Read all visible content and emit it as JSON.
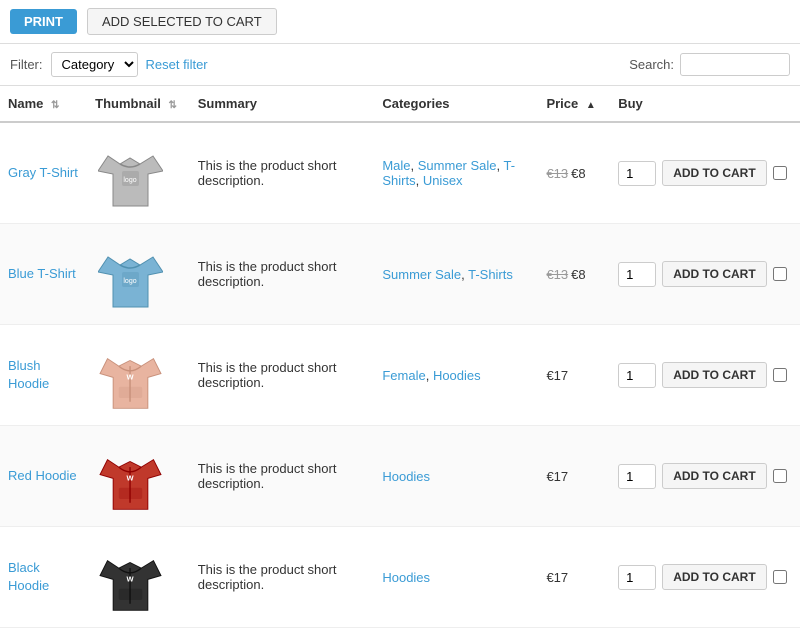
{
  "topBar": {
    "printLabel": "PRINT",
    "addSelectedLabel": "ADD SELECTED TO CART"
  },
  "filterBar": {
    "filterLabel": "Filter:",
    "categoryLabel": "Category",
    "resetLabel": "Reset filter",
    "searchLabel": "Search:",
    "searchPlaceholder": ""
  },
  "table": {
    "headers": [
      {
        "id": "name",
        "label": "Name",
        "sortable": true
      },
      {
        "id": "thumbnail",
        "label": "Thumbnail",
        "sortable": true
      },
      {
        "id": "summary",
        "label": "Summary",
        "sortable": false
      },
      {
        "id": "categories",
        "label": "Categories",
        "sortable": false
      },
      {
        "id": "price",
        "label": "Price",
        "sortable": true,
        "activeSort": "asc"
      },
      {
        "id": "buy",
        "label": "Buy",
        "sortable": false
      }
    ],
    "rows": [
      {
        "id": 1,
        "name": "Gray T-Shirt",
        "summary": "This is the product short description.",
        "categories": [
          "Male",
          "Summer Sale",
          "T-Shirts",
          "Unisex"
        ],
        "categoryLinks": [
          {
            "label": "Male",
            "sep": ", "
          },
          {
            "label": "Summer Sale",
            "sep": ", "
          },
          {
            "label": "T-Shirts",
            "sep": ", "
          },
          {
            "label": "Unisex",
            "sep": ""
          }
        ],
        "priceOriginal": "€13",
        "priceSale": "€8",
        "hasSale": true,
        "qty": "1",
        "cartLabel": "ADD TO CART",
        "color": "gray"
      },
      {
        "id": 2,
        "name": "Blue T-Shirt",
        "summary": "This is the product short description.",
        "categories": [
          "Summer Sale",
          "T-Shirts"
        ],
        "categoryLinks": [
          {
            "label": "Summer Sale",
            "sep": ", "
          },
          {
            "label": "T-Shirts",
            "sep": ""
          }
        ],
        "priceOriginal": "€13",
        "priceSale": "€8",
        "hasSale": true,
        "qty": "1",
        "cartLabel": "ADD TO CART",
        "color": "blue"
      },
      {
        "id": 3,
        "name": "Blush Hoodie",
        "summary": "This is the product short description.",
        "categories": [
          "Female",
          "Hoodies"
        ],
        "categoryLinks": [
          {
            "label": "Female",
            "sep": ", "
          },
          {
            "label": "Hoodies",
            "sep": ""
          }
        ],
        "priceOriginal": null,
        "priceSale": "€17",
        "hasSale": false,
        "qty": "1",
        "cartLabel": "ADD TO CART",
        "color": "blush"
      },
      {
        "id": 4,
        "name": "Red Hoodie",
        "summary": "This is the product short description.",
        "categories": [
          "Hoodies"
        ],
        "categoryLinks": [
          {
            "label": "Hoodies",
            "sep": ""
          }
        ],
        "priceOriginal": null,
        "priceSale": "€17",
        "hasSale": false,
        "qty": "1",
        "cartLabel": "ADD TO CART",
        "color": "red"
      },
      {
        "id": 5,
        "name": "Black Hoodie",
        "summary": "This is the product short description.",
        "categories": [
          "Hoodies"
        ],
        "categoryLinks": [
          {
            "label": "Hoodies",
            "sep": ""
          }
        ],
        "priceOriginal": null,
        "priceSale": "€17",
        "hasSale": false,
        "qty": "1",
        "cartLabel": "ADD TO CART",
        "color": "black"
      }
    ]
  }
}
